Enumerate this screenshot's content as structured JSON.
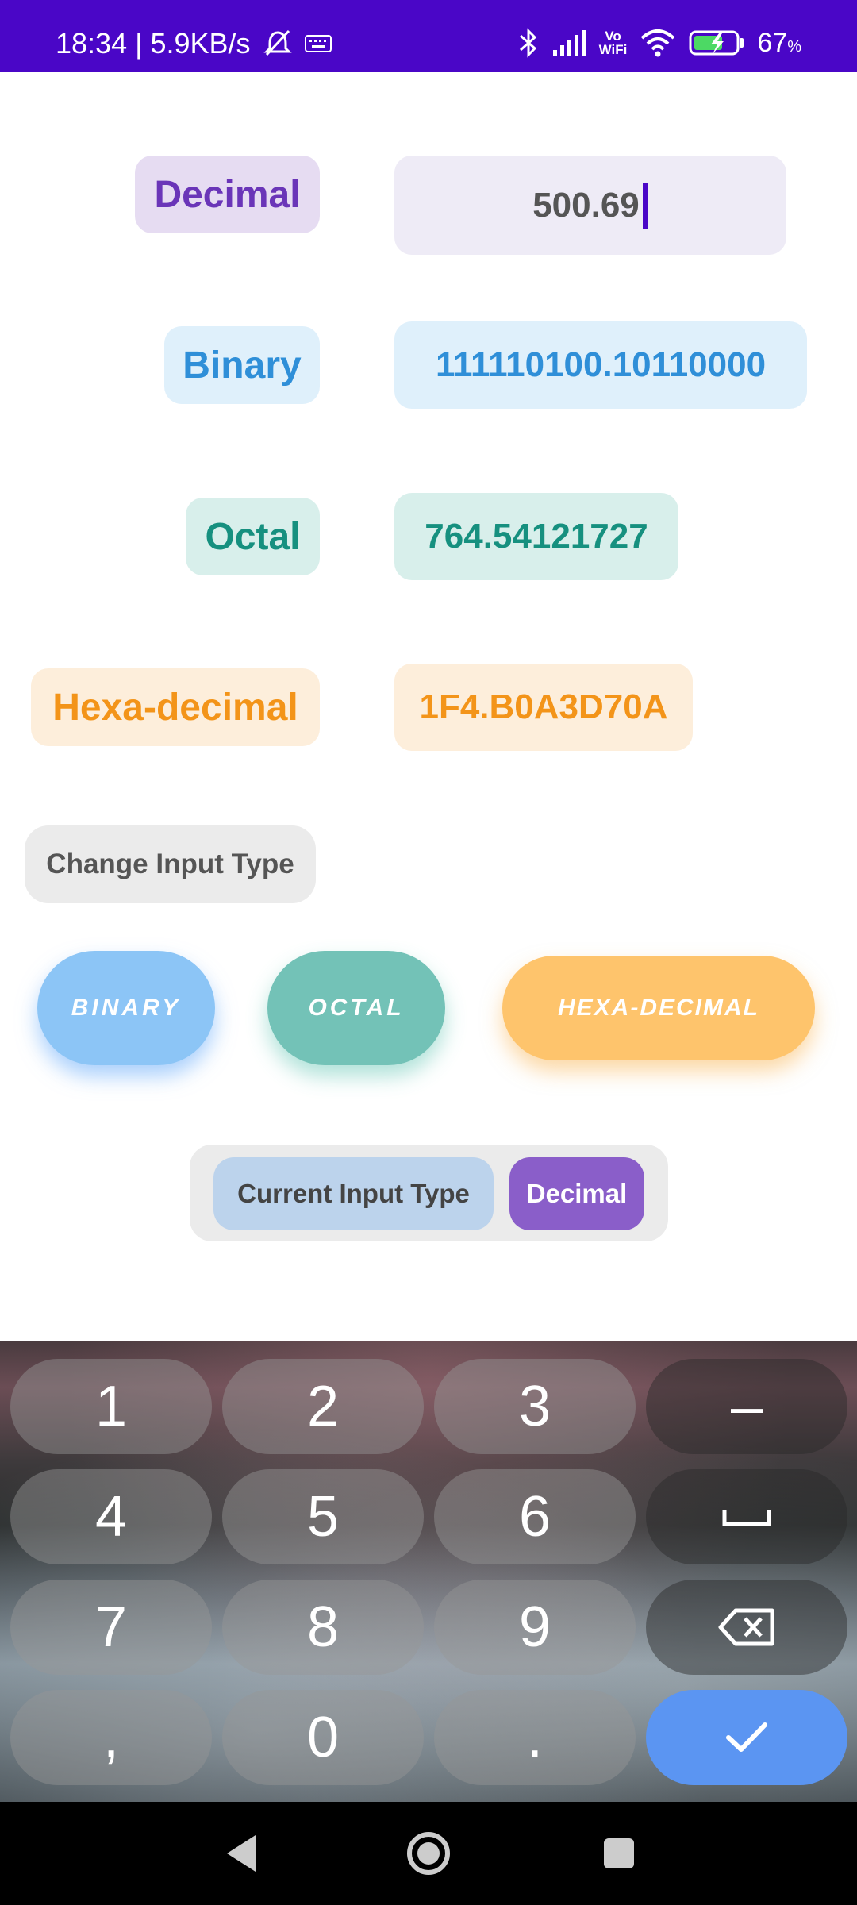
{
  "status_bar": {
    "time_speed": "18:34 | 5.9KB/s",
    "vowifi_line1": "Vo",
    "vowifi_line2": "WiFi",
    "battery_pct": "67",
    "battery_unit": "%"
  },
  "rows": {
    "decimal": {
      "label": "Decimal",
      "value": "500.69"
    },
    "binary": {
      "label": "Binary",
      "value": "111110100.10110000"
    },
    "octal": {
      "label": "Octal",
      "value": "764.54121727"
    },
    "hex": {
      "label": "Hexa-decimal",
      "value": "1F4.B0A3D70A"
    }
  },
  "change_input_type_label": "Change Input Type",
  "type_buttons": {
    "binary": "BINARY",
    "octal": "OCTAL",
    "hex": "HEXA-DECIMAL"
  },
  "current_input": {
    "label": "Current Input Type",
    "value": "Decimal"
  },
  "keyboard": {
    "keys": [
      "1",
      "2",
      "3",
      "–",
      "4",
      "5",
      "6",
      "␣",
      "7",
      "8",
      "9",
      "⌫",
      ",",
      "0",
      ".",
      "✓"
    ]
  },
  "colors": {
    "status_bar": "#4a06c7",
    "decimal": "#6a35b8",
    "binary": "#2f8fd8",
    "octal": "#16907f",
    "hex": "#f39419",
    "confirm_key": "#5b95f2"
  }
}
